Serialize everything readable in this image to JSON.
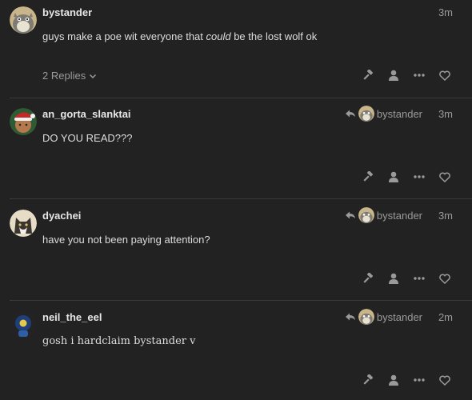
{
  "posts": [
    {
      "username": "bystander",
      "time": "3m",
      "text_before": "guys make a poe wit everyone that ",
      "text_em": "could",
      "text_after": " be the lost wolf ok",
      "replies_label": "2 Replies",
      "avatar": "totoro-avatar"
    },
    {
      "username": "an_gorta_slanktai",
      "time": "3m",
      "reply_to": "bystander",
      "text": "DO YOU READ???",
      "avatar": "santa-hat-avatar"
    },
    {
      "username": "dyachei",
      "time": "3m",
      "reply_to": "bystander",
      "text": "have you not been paying attention?",
      "avatar": "cat-avatar"
    },
    {
      "username": "neil_the_eel",
      "time": "2m",
      "reply_to": "bystander",
      "text": "gosh i hardclaim bystander v",
      "avatar": "character-avatar"
    }
  ],
  "icons": {
    "flag": "gavel-icon",
    "admin": "user-icon",
    "more": "ellipsis-icon",
    "like": "heart-icon",
    "reply": "reply-arrow-icon",
    "expand": "chevron-down-icon"
  },
  "colors": {
    "background": "#222222",
    "divider": "#3a3a3a",
    "muted": "#9a9a9a",
    "text": "#dddddd"
  }
}
